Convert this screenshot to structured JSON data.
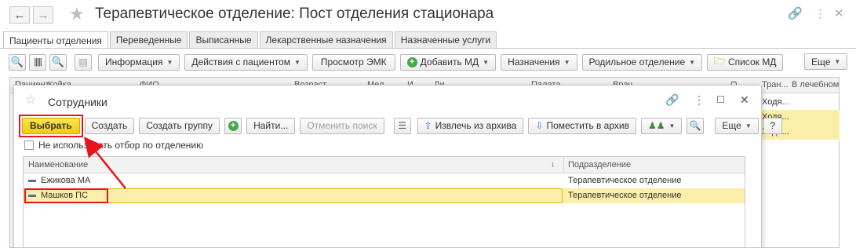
{
  "window": {
    "title": "Терапевтическое отделение: Пост отделения стационара"
  },
  "tabs": [
    {
      "label": "Пациенты отделения",
      "active": true
    },
    {
      "label": "Переведенные",
      "active": false
    },
    {
      "label": "Выписанные",
      "active": false
    },
    {
      "label": "Лекарственные назначения",
      "active": false
    },
    {
      "label": "Назначенные услуги",
      "active": false
    }
  ],
  "toolbar": {
    "info_label": "Информация",
    "actions_label": "Действия с пациентом",
    "emk_label": "Просмотр ЭМК",
    "add_md_label": "Добавить МД",
    "assignments_label": "Назначения",
    "maternity_label": "Родильное отделение",
    "md_list_label": "Список МД",
    "more_label": "Еще"
  },
  "background_table": {
    "columns": [
      "Пациент",
      "Койка",
      "ФИО",
      "Возраст",
      "Мед.",
      "И",
      "Ди",
      "Палата",
      "Врач",
      "О",
      "Тран...",
      "В лечебном"
    ],
    "rows": [
      "Ходя...",
      "Ходя...",
      "Ходя..."
    ]
  },
  "dialog": {
    "title": "Сотрудники",
    "select_label": "Выбрать",
    "create_label": "Создать",
    "create_group_label": "Создать группу",
    "find_label": "Найти...",
    "cancel_search_label": "Отменить поиск",
    "extract_archive_label": "Извлечь из архива",
    "move_archive_label": "Поместить в архив",
    "more_label": "Еще",
    "help_label": "?",
    "checkbox_label": "Не использовать отбор по отделению",
    "checkbox_checked": false,
    "list": {
      "col_name": "Наименование",
      "col_dept": "Подразделение",
      "rows": [
        {
          "name": "Ежикова МА",
          "dept": "Терапевтическое отделение",
          "selected": false
        },
        {
          "name": "Машков ПС",
          "dept": "Терапевтическое отделение",
          "selected": true
        }
      ]
    }
  },
  "colors": {
    "accent_yellow": "#f2cc0c",
    "selection": "#fbeea8",
    "annotation_red": "#e8141b",
    "tree_marker": "#4c6fa8"
  }
}
